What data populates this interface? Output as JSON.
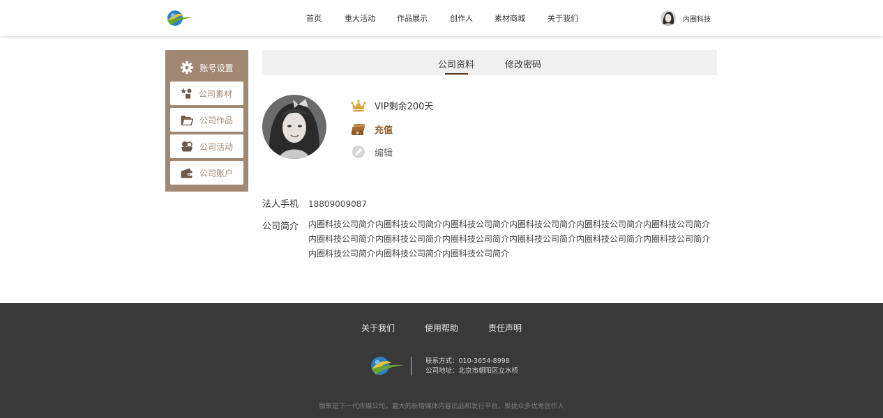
{
  "colors": {
    "accent": "#a08873",
    "brand_dark": "#5a3d22",
    "footer_bg": "#393939",
    "crown": "#d9a441"
  },
  "header": {
    "logo_icon": "globe-logo-icon",
    "nav": [
      {
        "label": "首页"
      },
      {
        "label": "重大活动"
      },
      {
        "label": "作品展示"
      },
      {
        "label": "创作人"
      },
      {
        "label": "素材商城"
      },
      {
        "label": "关于我们"
      }
    ],
    "user_name": "内圈科技"
  },
  "sidebar": {
    "title": "账号设置",
    "title_icon": "gear-icon",
    "items": [
      {
        "label": "公司素材",
        "icon": "shapes-icon"
      },
      {
        "label": "公司作品",
        "icon": "folder-open-icon"
      },
      {
        "label": "公司活动",
        "icon": "activity-icon"
      },
      {
        "label": "公司账户",
        "icon": "wallet-icon"
      }
    ]
  },
  "tabs": [
    {
      "label": "公司资料",
      "active": true
    },
    {
      "label": "修改密码",
      "active": false
    }
  ],
  "profile": {
    "vip_text": "VIP剩余200天",
    "recharge_label": "充值",
    "edit_label": "编辑",
    "phone_label": "法人手机",
    "phone_value": "18809009087",
    "intro_label": "公司简介",
    "intro_value": "内圈科技公司简介内圈科技公司简介内圈科技公司简介内圈科技公司简介内圈科技公司简介内圈科技公司简介内圈科技公司简介内圈科技公司简介内圈科技公司简介内圈科技公司简介内圈科技公司简介内圈科技公司简介内圈科技公司简介内圈科技公司简介内圈科技公司简介"
  },
  "footer": {
    "links": [
      {
        "label": "关于我们"
      },
      {
        "label": "使用帮助"
      },
      {
        "label": "责任声明"
      }
    ],
    "contact": "联系方式：010-3654-8998",
    "address": "公司地址：北京市朝阳区立水桥",
    "slogan": "微聚是下一代传媒公司，最大的新增媒体内容出品和发行平台，聚拢众多优秀创作人"
  }
}
